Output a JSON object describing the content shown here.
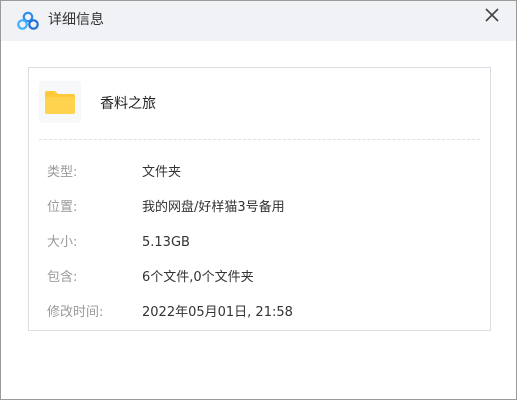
{
  "window": {
    "title": "详细信息"
  },
  "file": {
    "name": "香料之旅",
    "icon": "folder-icon"
  },
  "details": [
    {
      "label": "类型:",
      "value": "文件夹"
    },
    {
      "label": "位置:",
      "value": "我的网盘/好样猫3号备用"
    },
    {
      "label": "大小:",
      "value": "5.13GB"
    },
    {
      "label": "包含:",
      "value": "6个文件,0个文件夹"
    },
    {
      "label": "修改时间:",
      "value": "2022年05月01日, 21:58"
    }
  ],
  "colors": {
    "titlebar_bg": "#f0f2f5",
    "folder": "#ffc93c",
    "logo_blue": "#2d8cf0"
  }
}
